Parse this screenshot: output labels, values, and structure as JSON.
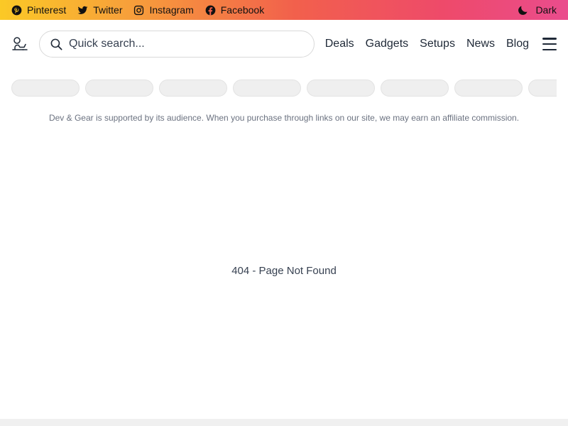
{
  "topbar": {
    "social": [
      {
        "label": "Pinterest",
        "icon": "pinterest-icon"
      },
      {
        "label": "Twitter",
        "icon": "twitter-icon"
      },
      {
        "label": "Instagram",
        "icon": "instagram-icon"
      },
      {
        "label": "Facebook",
        "icon": "facebook-icon"
      }
    ],
    "theme_toggle": {
      "label": "Dark",
      "icon": "moon-icon"
    }
  },
  "header": {
    "logo_icon": "desk-logo-icon",
    "search": {
      "placeholder": "Quick search...",
      "value": "",
      "icon": "search-icon"
    },
    "nav": [
      "Deals",
      "Gadgets",
      "Setups",
      "News",
      "Blog"
    ],
    "menu_icon": "hamburger-icon"
  },
  "category_pills": {
    "count": 8,
    "state": "loading"
  },
  "disclaimer": "Dev & Gear is supported by its audience. When you purchase through links on our site, we may earn an affiliate commission.",
  "main": {
    "message": "404 - Page Not Found"
  },
  "colors": {
    "topbar_gradient": [
      "#fbc926",
      "#f7a13a",
      "#f2604c",
      "#ee4a6a",
      "#ea4c8d"
    ],
    "text": "#1f2937",
    "pill": "#efefef"
  }
}
